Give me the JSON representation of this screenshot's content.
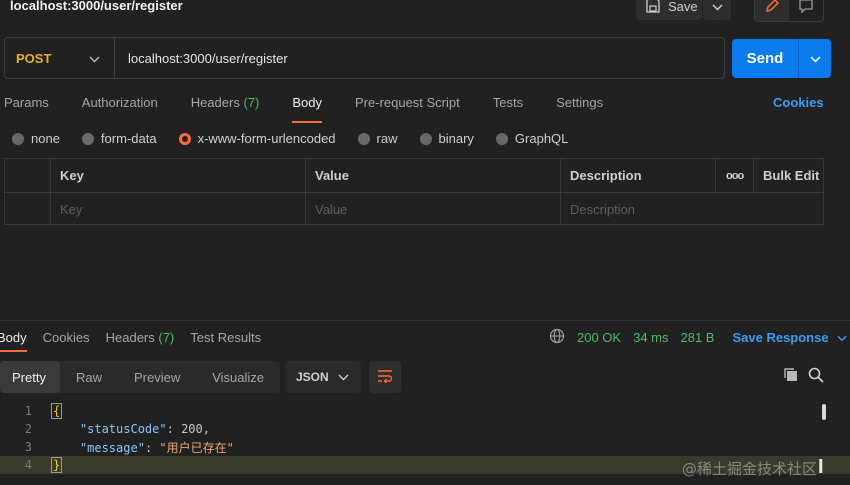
{
  "tab": {
    "title": "localhost:3000/user/register"
  },
  "toolbar": {
    "save_label": "Save"
  },
  "request": {
    "method": "POST",
    "url": "localhost:3000/user/register",
    "send_label": "Send",
    "tabs": [
      {
        "label": "Params"
      },
      {
        "label": "Authorization"
      },
      {
        "label": "Headers",
        "count": "(7)"
      },
      {
        "label": "Body"
      },
      {
        "label": "Pre-request Script"
      },
      {
        "label": "Tests"
      },
      {
        "label": "Settings"
      }
    ],
    "cookies_label": "Cookies",
    "body_types": [
      "none",
      "form-data",
      "x-www-form-urlencoded",
      "raw",
      "binary",
      "GraphQL"
    ],
    "selected_body_type": "x-www-form-urlencoded"
  },
  "kv_table": {
    "headers": {
      "key": "Key",
      "value": "Value",
      "description": "Description",
      "more": "ooo",
      "bulk_edit": "Bulk Edit"
    },
    "placeholders": {
      "key": "Key",
      "value": "Value",
      "description": "Description"
    }
  },
  "response": {
    "tabs": [
      {
        "label": "Body"
      },
      {
        "label": "Cookies"
      },
      {
        "label": "Headers",
        "count": "(7)"
      },
      {
        "label": "Test Results"
      }
    ],
    "status": "200 OK",
    "time": "34 ms",
    "size": "281 B",
    "save_response_label": "Save Response",
    "view_modes": [
      "Pretty",
      "Raw",
      "Preview",
      "Visualize"
    ],
    "format": "JSON",
    "lines": [
      {
        "num": "1",
        "open": "{"
      },
      {
        "num": "2",
        "key": "\"statusCode\"",
        "sep": ": ",
        "val": "200",
        "end": ","
      },
      {
        "num": "3",
        "key": "\"message\"",
        "sep": ": ",
        "val": "\"用户已存在\""
      },
      {
        "num": "4",
        "close": "}"
      }
    ]
  },
  "watermark": "@稀土掘金技术社区",
  "colors": {
    "accent": "#ff6c37",
    "send": "#097bed",
    "success": "#4fba69",
    "link": "#3d9bf0",
    "method": "#e8b020"
  }
}
